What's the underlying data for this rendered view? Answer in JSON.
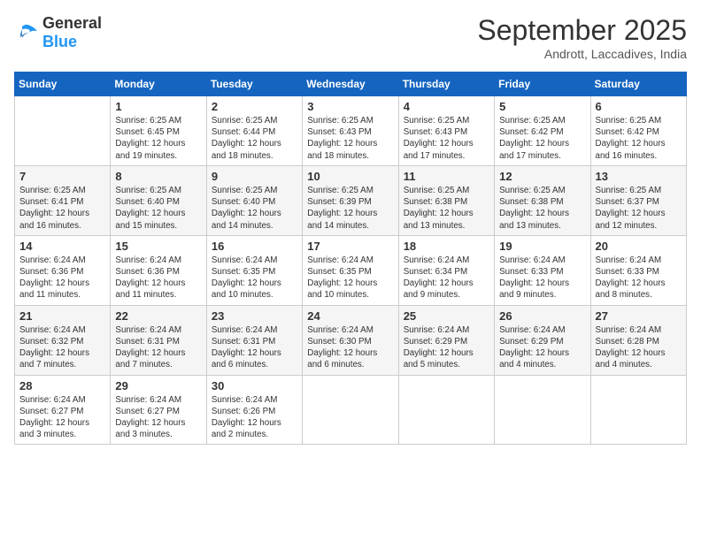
{
  "logo": {
    "general": "General",
    "blue": "Blue"
  },
  "title": "September 2025",
  "subtitle": "Andrott, Laccadives, India",
  "days_of_week": [
    "Sunday",
    "Monday",
    "Tuesday",
    "Wednesday",
    "Thursday",
    "Friday",
    "Saturday"
  ],
  "weeks": [
    [
      {
        "day": "",
        "info": ""
      },
      {
        "day": "1",
        "info": "Sunrise: 6:25 AM\nSunset: 6:45 PM\nDaylight: 12 hours\nand 19 minutes."
      },
      {
        "day": "2",
        "info": "Sunrise: 6:25 AM\nSunset: 6:44 PM\nDaylight: 12 hours\nand 18 minutes."
      },
      {
        "day": "3",
        "info": "Sunrise: 6:25 AM\nSunset: 6:43 PM\nDaylight: 12 hours\nand 18 minutes."
      },
      {
        "day": "4",
        "info": "Sunrise: 6:25 AM\nSunset: 6:43 PM\nDaylight: 12 hours\nand 17 minutes."
      },
      {
        "day": "5",
        "info": "Sunrise: 6:25 AM\nSunset: 6:42 PM\nDaylight: 12 hours\nand 17 minutes."
      },
      {
        "day": "6",
        "info": "Sunrise: 6:25 AM\nSunset: 6:42 PM\nDaylight: 12 hours\nand 16 minutes."
      }
    ],
    [
      {
        "day": "7",
        "info": "Sunrise: 6:25 AM\nSunset: 6:41 PM\nDaylight: 12 hours\nand 16 minutes."
      },
      {
        "day": "8",
        "info": "Sunrise: 6:25 AM\nSunset: 6:40 PM\nDaylight: 12 hours\nand 15 minutes."
      },
      {
        "day": "9",
        "info": "Sunrise: 6:25 AM\nSunset: 6:40 PM\nDaylight: 12 hours\nand 14 minutes."
      },
      {
        "day": "10",
        "info": "Sunrise: 6:25 AM\nSunset: 6:39 PM\nDaylight: 12 hours\nand 14 minutes."
      },
      {
        "day": "11",
        "info": "Sunrise: 6:25 AM\nSunset: 6:38 PM\nDaylight: 12 hours\nand 13 minutes."
      },
      {
        "day": "12",
        "info": "Sunrise: 6:25 AM\nSunset: 6:38 PM\nDaylight: 12 hours\nand 13 minutes."
      },
      {
        "day": "13",
        "info": "Sunrise: 6:25 AM\nSunset: 6:37 PM\nDaylight: 12 hours\nand 12 minutes."
      }
    ],
    [
      {
        "day": "14",
        "info": "Sunrise: 6:24 AM\nSunset: 6:36 PM\nDaylight: 12 hours\nand 11 minutes."
      },
      {
        "day": "15",
        "info": "Sunrise: 6:24 AM\nSunset: 6:36 PM\nDaylight: 12 hours\nand 11 minutes."
      },
      {
        "day": "16",
        "info": "Sunrise: 6:24 AM\nSunset: 6:35 PM\nDaylight: 12 hours\nand 10 minutes."
      },
      {
        "day": "17",
        "info": "Sunrise: 6:24 AM\nSunset: 6:35 PM\nDaylight: 12 hours\nand 10 minutes."
      },
      {
        "day": "18",
        "info": "Sunrise: 6:24 AM\nSunset: 6:34 PM\nDaylight: 12 hours\nand 9 minutes."
      },
      {
        "day": "19",
        "info": "Sunrise: 6:24 AM\nSunset: 6:33 PM\nDaylight: 12 hours\nand 9 minutes."
      },
      {
        "day": "20",
        "info": "Sunrise: 6:24 AM\nSunset: 6:33 PM\nDaylight: 12 hours\nand 8 minutes."
      }
    ],
    [
      {
        "day": "21",
        "info": "Sunrise: 6:24 AM\nSunset: 6:32 PM\nDaylight: 12 hours\nand 7 minutes."
      },
      {
        "day": "22",
        "info": "Sunrise: 6:24 AM\nSunset: 6:31 PM\nDaylight: 12 hours\nand 7 minutes."
      },
      {
        "day": "23",
        "info": "Sunrise: 6:24 AM\nSunset: 6:31 PM\nDaylight: 12 hours\nand 6 minutes."
      },
      {
        "day": "24",
        "info": "Sunrise: 6:24 AM\nSunset: 6:30 PM\nDaylight: 12 hours\nand 6 minutes."
      },
      {
        "day": "25",
        "info": "Sunrise: 6:24 AM\nSunset: 6:29 PM\nDaylight: 12 hours\nand 5 minutes."
      },
      {
        "day": "26",
        "info": "Sunrise: 6:24 AM\nSunset: 6:29 PM\nDaylight: 12 hours\nand 4 minutes."
      },
      {
        "day": "27",
        "info": "Sunrise: 6:24 AM\nSunset: 6:28 PM\nDaylight: 12 hours\nand 4 minutes."
      }
    ],
    [
      {
        "day": "28",
        "info": "Sunrise: 6:24 AM\nSunset: 6:27 PM\nDaylight: 12 hours\nand 3 minutes."
      },
      {
        "day": "29",
        "info": "Sunrise: 6:24 AM\nSunset: 6:27 PM\nDaylight: 12 hours\nand 3 minutes."
      },
      {
        "day": "30",
        "info": "Sunrise: 6:24 AM\nSunset: 6:26 PM\nDaylight: 12 hours\nand 2 minutes."
      },
      {
        "day": "",
        "info": ""
      },
      {
        "day": "",
        "info": ""
      },
      {
        "day": "",
        "info": ""
      },
      {
        "day": "",
        "info": ""
      }
    ]
  ]
}
